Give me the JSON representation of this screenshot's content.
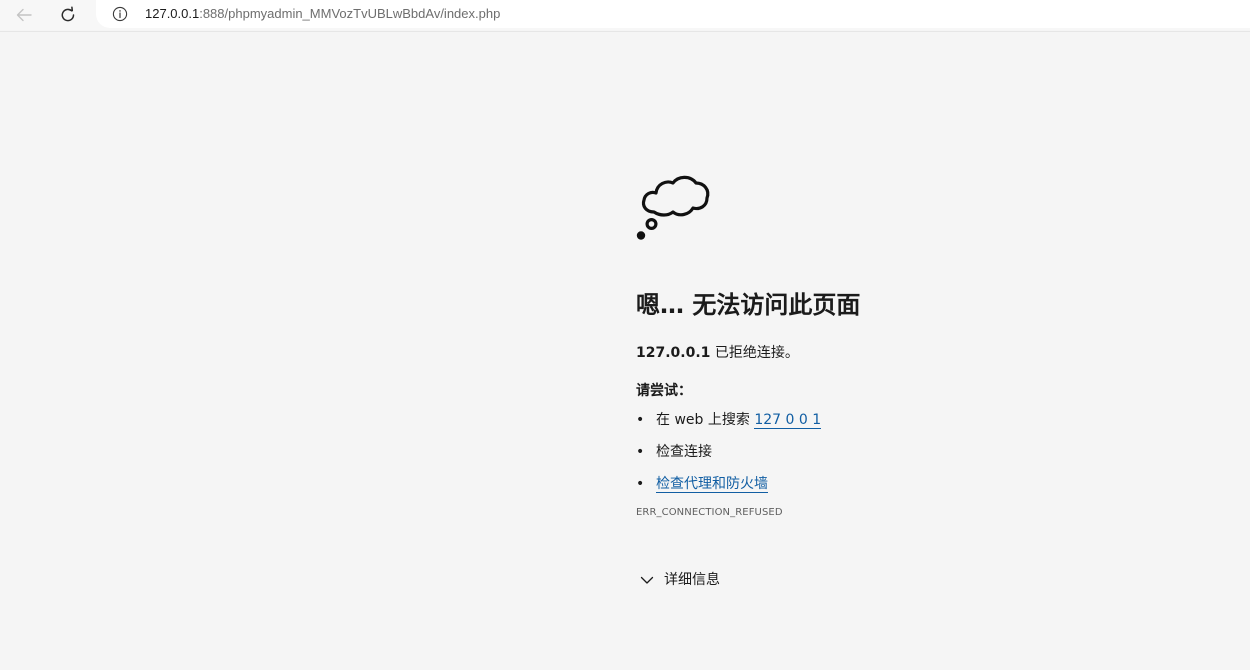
{
  "browser": {
    "url_host": "127.0.0.1",
    "url_rest": ":888/phpmyadmin_MMVozTvUBLwBbdAv/index.php"
  },
  "error": {
    "title": "嗯… 无法访问此页面",
    "host": "127.0.0.1",
    "message_suffix": " 已拒绝连接。",
    "try_label": "请尝试：",
    "suggestions": [
      {
        "prefix": "在 web 上搜索 ",
        "link": "127 0 0 1"
      },
      {
        "text": "检查连接"
      },
      {
        "link": "检查代理和防火墙"
      }
    ],
    "code": "ERR_CONNECTION_REFUSED",
    "details_label": "详细信息"
  },
  "icons": {
    "back": "back-arrow-icon",
    "reload": "reload-icon",
    "info": "info-icon",
    "cloud": "thought-cloud-icon",
    "chevron": "chevron-down-icon"
  },
  "colors": {
    "background": "#f5f5f5",
    "link": "#115ea3",
    "text": "#1b1b1b"
  }
}
